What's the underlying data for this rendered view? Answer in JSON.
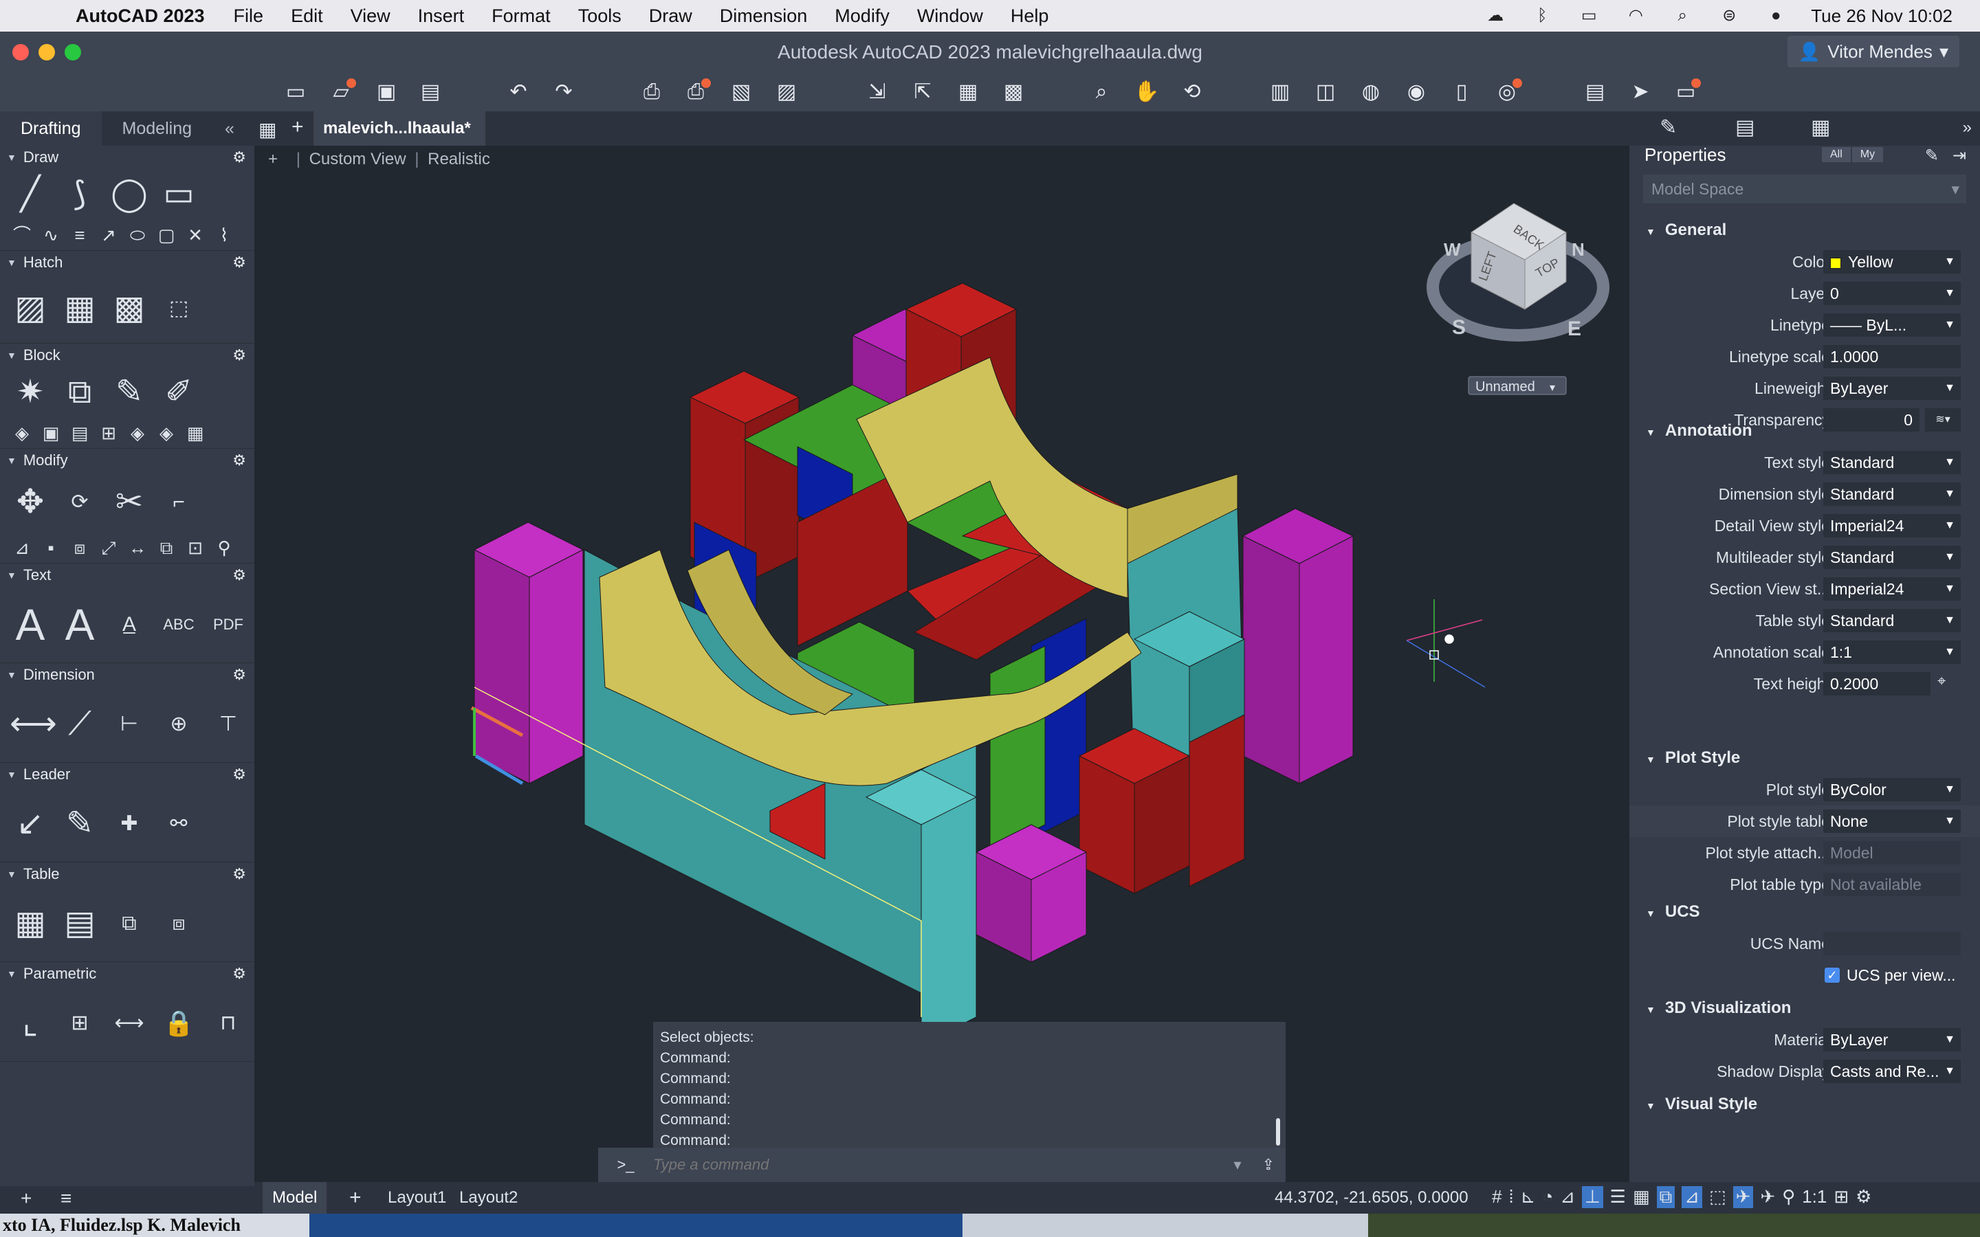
{
  "menubar": {
    "app_name": "AutoCAD 2023",
    "items": [
      "File",
      "Edit",
      "View",
      "Insert",
      "Format",
      "Tools",
      "Draw",
      "Dimension",
      "Modify",
      "Window",
      "Help"
    ],
    "clock": "Tue 26 Nov  10:02"
  },
  "titlebar": {
    "title": "Autodesk AutoCAD 2023    malevichgrelhaaula.dwg",
    "user": "Vitor Mendes"
  },
  "palette": {
    "tabs": [
      "Drafting",
      "Modeling"
    ],
    "sections": [
      "Draw",
      "Hatch",
      "Block",
      "Modify",
      "Text",
      "Dimension",
      "Leader",
      "Table",
      "Parametric"
    ]
  },
  "document": {
    "tab_label": "malevich...lhaaula*",
    "view_label": "Custom View",
    "style_label": "Realistic",
    "viewcube_label": "Unnamed",
    "viewcube_faces": {
      "top": "TOP",
      "left": "LEFT",
      "back": "BACK"
    },
    "compass": {
      "s": "S",
      "e": "E",
      "w": "W",
      "n": "N"
    }
  },
  "command": {
    "history": [
      "Select objects:",
      "Command:",
      "Command:",
      "Command:",
      "Command:",
      "Command:"
    ],
    "prompt": ">_",
    "placeholder": "Type a command"
  },
  "properties": {
    "title": "Properties",
    "filter_all": "All",
    "filter_my": "My",
    "scope": "Model Space",
    "general": {
      "heading": "General",
      "rows": [
        {
          "label": "Color",
          "value": "Yellow"
        },
        {
          "label": "Layer",
          "value": "0"
        },
        {
          "label": "Linetype",
          "value": "—— ByL..."
        },
        {
          "label": "Linetype scale",
          "value": "1.0000"
        },
        {
          "label": "Lineweight",
          "value": "ByLayer"
        },
        {
          "label": "Transparency",
          "value": "0"
        }
      ]
    },
    "annotation": {
      "heading": "Annotation",
      "rows": [
        {
          "label": "Text style",
          "value": "Standard"
        },
        {
          "label": "Dimension style",
          "value": "Standard"
        },
        {
          "label": "Detail View style",
          "value": "Imperial24"
        },
        {
          "label": "Multileader style",
          "value": "Standard"
        },
        {
          "label": "Section View st...",
          "value": "Imperial24"
        },
        {
          "label": "Table style",
          "value": "Standard"
        },
        {
          "label": "Annotation scale",
          "value": "1:1"
        },
        {
          "label": "Text height",
          "value": "0.2000"
        }
      ]
    },
    "plot_style": {
      "heading": "Plot Style",
      "rows": [
        {
          "label": "Plot style",
          "value": "ByColor"
        },
        {
          "label": "Plot style table",
          "value": "None"
        },
        {
          "label": "Plot style attach...",
          "value": "Model"
        },
        {
          "label": "Plot table type",
          "value": "Not available"
        }
      ]
    },
    "ucs": {
      "heading": "UCS",
      "rows": [
        {
          "label": "UCS Name",
          "value": ""
        },
        {
          "label": "",
          "value": "UCS per view..."
        }
      ]
    },
    "visualization": {
      "heading": "3D Visualization",
      "rows": [
        {
          "label": "Material",
          "value": "ByLayer"
        },
        {
          "label": "Shadow Display",
          "value": "Casts and Re..."
        }
      ]
    },
    "visual_style": {
      "heading": "Visual Style"
    }
  },
  "statusbar": {
    "tabs": [
      "Model",
      "Layout1",
      "Layout2"
    ],
    "coords": "44.3702,   -21.6505, 0.0000",
    "scale": "1:1"
  },
  "footer": {
    "text": "xto IA, Fluidez.lsp K. Malevich"
  }
}
